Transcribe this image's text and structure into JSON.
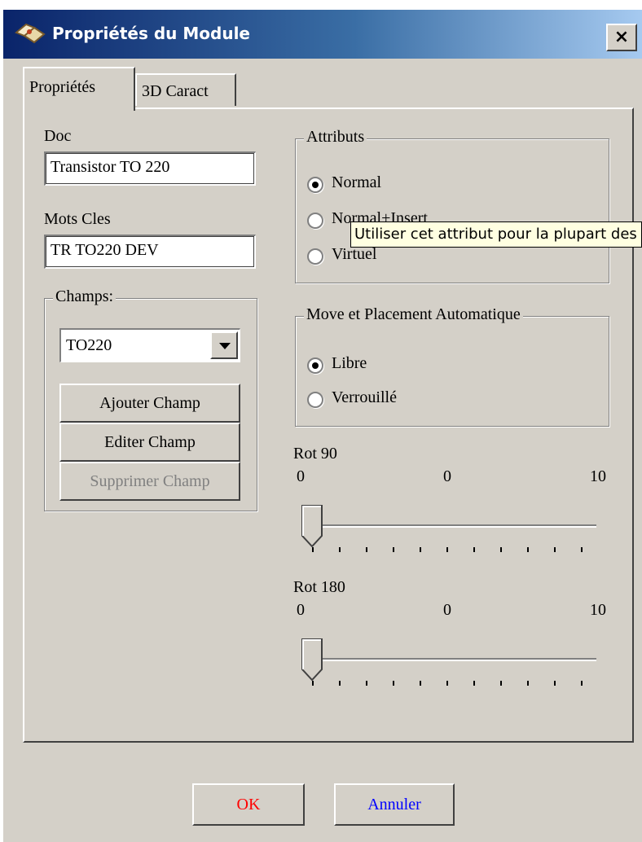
{
  "window": {
    "title": "Propriétés du Module",
    "close_label": "×"
  },
  "tabs": [
    {
      "label": "Propriétés"
    },
    {
      "label": "3D Caract"
    }
  ],
  "doc": {
    "label": "Doc",
    "value": "Transistor TO 220"
  },
  "keywords": {
    "label": "Mots Cles",
    "value": "TR TO220 DEV"
  },
  "fields": {
    "legend": "Champs:",
    "selected": "TO220",
    "add_label": "Ajouter Champ",
    "edit_label": "Editer Champ",
    "delete_label": "Supprimer Champ"
  },
  "attributes": {
    "legend": "Attributs",
    "options": [
      {
        "label": "Normal",
        "checked": true
      },
      {
        "label": "Normal+Insert",
        "checked": false
      },
      {
        "label": "Virtuel",
        "checked": false
      }
    ]
  },
  "placement": {
    "legend": "Move et Placement Automatique",
    "options": [
      {
        "label": "Libre",
        "checked": true
      },
      {
        "label": "Verrouillé",
        "checked": false
      }
    ]
  },
  "rot90": {
    "label": "Rot 90",
    "min": "0",
    "value": "0",
    "max": "10",
    "level": 0
  },
  "rot180": {
    "label": "Rot 180",
    "min": "0",
    "value": "0",
    "max": "10",
    "level": 0
  },
  "tooltip": "Utiliser cet attribut pour la plupart des",
  "buttons": {
    "ok": "OK",
    "cancel": "Annuler"
  },
  "colors": {
    "ok_text": "#ff0000",
    "cancel_text": "#0000ff",
    "disabled_text": "#808080"
  },
  "icons": {
    "title": "module-icon",
    "dropdown": "chevron-down-icon"
  }
}
